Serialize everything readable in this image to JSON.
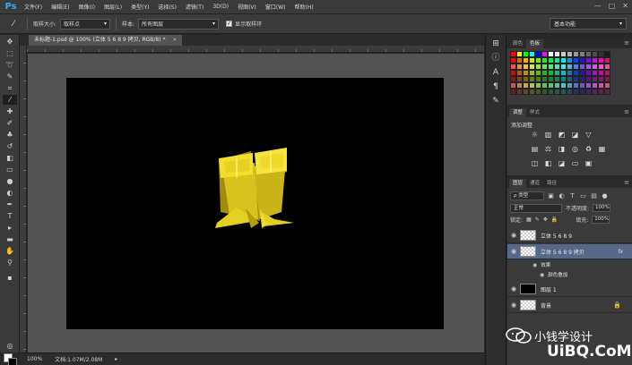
{
  "app": {
    "logo": "Ps",
    "menu": [
      "文件(F)",
      "编辑(E)",
      "图像(I)",
      "图层(L)",
      "类型(Y)",
      "选择(S)",
      "滤镜(T)",
      "3D(D)",
      "视图(V)",
      "窗口(W)",
      "帮助(H)"
    ],
    "window_controls": [
      "—",
      "□",
      "✕"
    ]
  },
  "options_bar": {
    "sample_size_label": "取样大小:",
    "sample_size_value": "取样点",
    "sample_label": "样本:",
    "sample_value": "所有图层",
    "show_ring_label": "显示取样环",
    "workspace": "基本功能"
  },
  "document": {
    "tab_title": "未标题-1.psd @ 100% (立体 5 6 8 9 拷贝, RGB/8) *",
    "zoom": "100%",
    "doc_info": "文档:1.07M/2.08M"
  },
  "panels": {
    "color_tabs": [
      "颜色",
      "色板"
    ],
    "adjust_tabs": [
      "调整",
      "样式"
    ],
    "adjust_title": "添加调整",
    "layers_tabs": [
      "图层",
      "通道",
      "路径"
    ],
    "filter_label": "ρ 类型",
    "blend_mode": "正常",
    "opacity_label": "不透明度:",
    "opacity_value": "100%",
    "lock_label": "锁定:",
    "fill_label": "填充:",
    "fill_value": "100%",
    "layers": [
      {
        "name": "立体 5 6 8 9",
        "type": "normal"
      },
      {
        "name": "立体 5 6 8 9 拷贝",
        "type": "selected",
        "fx": "fx"
      },
      {
        "name": "效果",
        "type": "effect-group"
      },
      {
        "name": "颜色叠加",
        "type": "effect"
      },
      {
        "name": "图层 1",
        "type": "black"
      },
      {
        "name": "背景",
        "type": "background"
      }
    ]
  },
  "watermark": {
    "name": "小钱学设计",
    "url": "UiBQ.CoM"
  },
  "colors": {
    "chrome": "#3a3a3a",
    "canvas": "#000000",
    "pasteboard": "#535353",
    "selection": "#56688a",
    "art_yellow": "#f2dc2a"
  }
}
